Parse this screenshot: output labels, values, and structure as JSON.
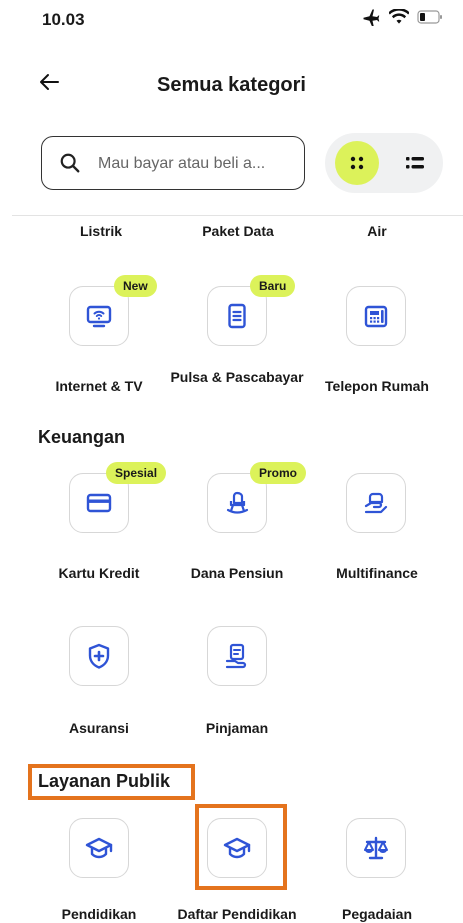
{
  "status_bar": {
    "time": "10.03",
    "icons": [
      "airplane-icon",
      "wifi-icon",
      "battery-icon"
    ]
  },
  "header": {
    "back_icon": "arrow-left-icon",
    "title": "Semua kategori"
  },
  "search": {
    "placeholder": "Mau bayar atau beli a...",
    "value": ""
  },
  "view_toggle": {
    "grid_icon": "grid-dots-icon",
    "list_icon": "list-icon",
    "active": "grid"
  },
  "top_row_labels": [
    "Listrik",
    "Paket Data",
    "Air"
  ],
  "utilities": [
    {
      "label": "Internet & TV",
      "badge": "New",
      "icon": "tv-wifi-icon"
    },
    {
      "label": "Pulsa & Pascabayar",
      "badge": "Baru",
      "icon": "phone-document-icon"
    },
    {
      "label": "Telepon Rumah",
      "badge": "",
      "icon": "landline-phone-icon"
    }
  ],
  "keuangan": {
    "title": "Keuangan",
    "items": [
      {
        "label": "Kartu Kredit",
        "badge": "Spesial",
        "icon": "credit-card-icon"
      },
      {
        "label": "Dana Pensiun",
        "badge": "Promo",
        "icon": "rocking-chair-icon"
      },
      {
        "label": "Multifinance",
        "badge": "",
        "icon": "hand-money-icon"
      },
      {
        "label": "Asuransi",
        "badge": "",
        "icon": "shield-plus-icon"
      },
      {
        "label": "Pinjaman",
        "badge": "",
        "icon": "loan-document-icon"
      }
    ]
  },
  "layanan_publik": {
    "title": "Layanan Publik",
    "items": [
      {
        "label": "Pendidikan",
        "icon": "graduation-cap-icon"
      },
      {
        "label": "Daftar Pendidikan",
        "icon": "graduation-cap-icon"
      },
      {
        "label": "Pegadaian",
        "icon": "balance-scale-icon"
      }
    ]
  },
  "colors": {
    "accent_green": "#dcf25a",
    "icon_blue": "#2f54d6",
    "highlight_orange": "#e4731d"
  }
}
